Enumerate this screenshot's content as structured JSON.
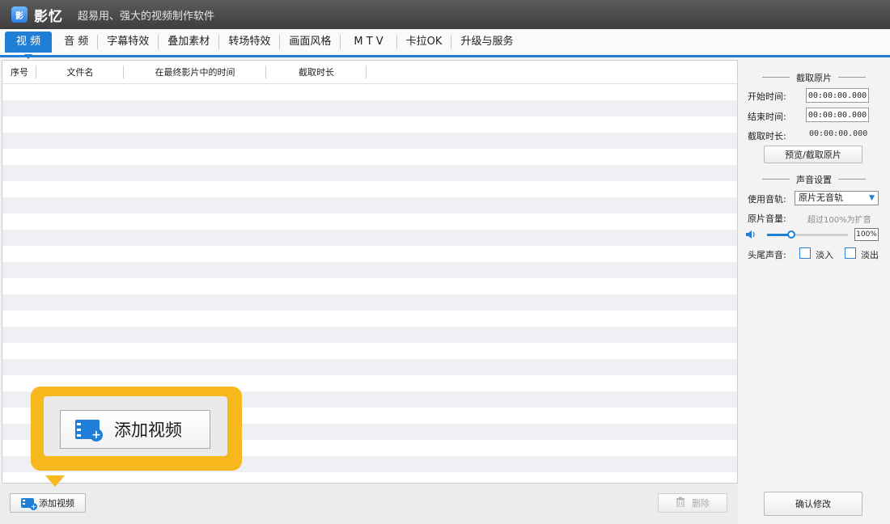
{
  "app": {
    "logo_text": "影",
    "name": "影忆",
    "slogan": "超易用、强大的视频制作软件"
  },
  "tabs": [
    {
      "label": "视  频",
      "active": true
    },
    {
      "label": "音  频"
    },
    {
      "label": "字幕特效"
    },
    {
      "label": "叠加素材"
    },
    {
      "label": "转场特效"
    },
    {
      "label": "画面风格"
    },
    {
      "label": "M T V"
    },
    {
      "label": "卡拉OK"
    },
    {
      "label": "升级与服务"
    }
  ],
  "list": {
    "columns": [
      "序号",
      "文件名",
      "在最终影片中的时间",
      "截取时长"
    ]
  },
  "bottom": {
    "add_video": "添加视频",
    "delete": "删除"
  },
  "callout": {
    "label": "添加视频",
    "color": "#f6b81c"
  },
  "right": {
    "clip_title": "截取原片",
    "start_label": "开始时间:",
    "start_value": "00:00:00.000",
    "end_label": "结束时间:",
    "end_value": "00:00:00.000",
    "duration_label": "截取时长:",
    "duration_value": "00:00:00.000",
    "preview_button": "预览/截取原片",
    "sound_title": "声音设置",
    "track_label": "使用音轨:",
    "track_value": "原片无音轨",
    "volume_label": "原片音量:",
    "volume_hint": "超过100%为扩音",
    "volume_value": "100%",
    "volume_level": 0.3,
    "fade_label": "头尾声音:",
    "fade_in": "淡入",
    "fade_out": "淡出",
    "confirm_button": "确认修改"
  },
  "colors": {
    "accent": "#1f7fd6",
    "highlight": "#f6b81c"
  },
  "icons": [
    "video-add-icon",
    "trash-icon",
    "speaker-icon",
    "dropdown-arrow-icon"
  ]
}
